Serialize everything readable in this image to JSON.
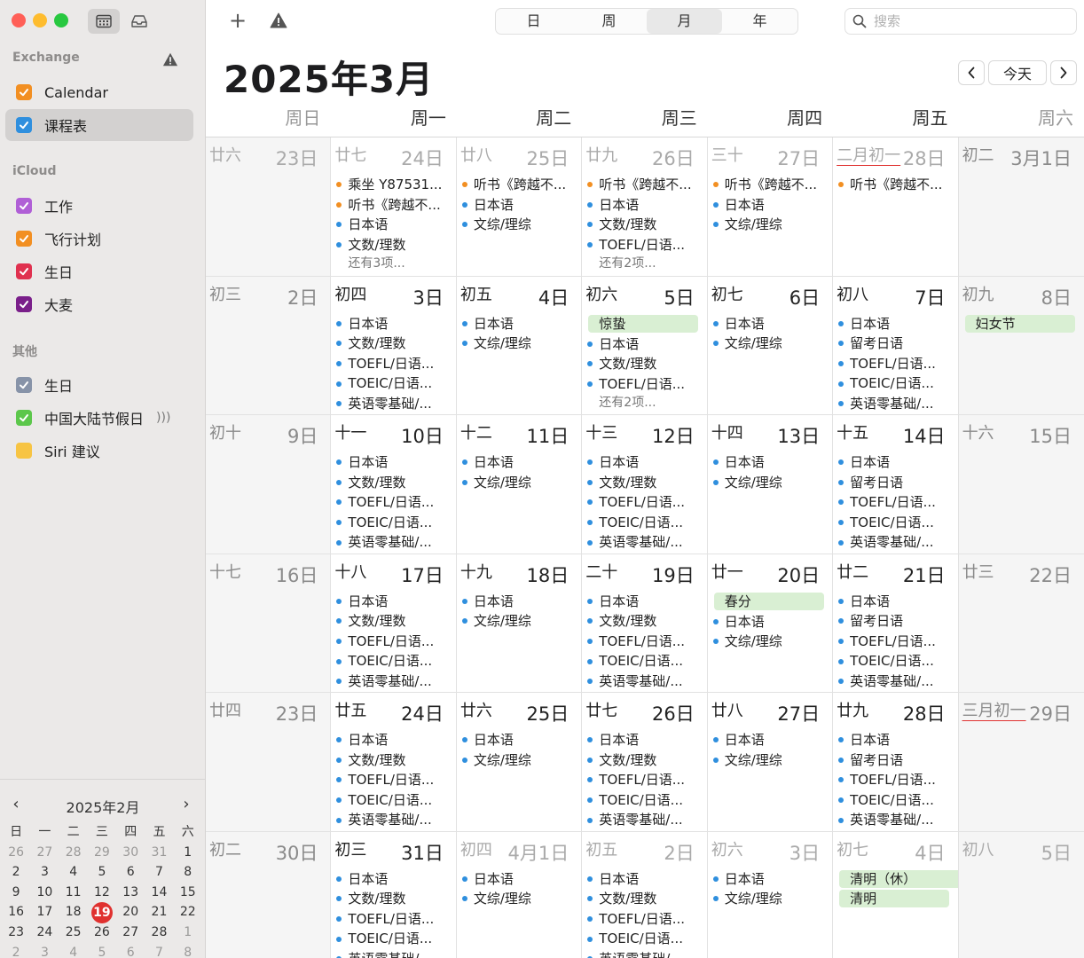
{
  "sidebar": {
    "sections": [
      {
        "title": "Exchange",
        "warning": true,
        "items": [
          {
            "label": "Calendar",
            "color": "#f28f22",
            "selected": false
          },
          {
            "label": "课程表",
            "color": "#2f8fde",
            "selected": true
          }
        ]
      },
      {
        "title": "iCloud",
        "items": [
          {
            "label": "工作",
            "color": "#b05fd6"
          },
          {
            "label": "飞行计划",
            "color": "#f28f22"
          },
          {
            "label": "生日",
            "color": "#e0314f"
          },
          {
            "label": "大麦",
            "color": "#7a1f8a"
          }
        ]
      },
      {
        "title": "其他",
        "items": [
          {
            "label": "生日",
            "color": "#8793a8"
          },
          {
            "label": "中国大陆节假日",
            "color": "#5cc74b",
            "broadcast": true
          },
          {
            "label": "Siri 建议",
            "color": "#f7c443",
            "unchecked": true
          }
        ]
      }
    ],
    "mini_calendar": {
      "title": "2025年2月",
      "weekday_heads": [
        "日",
        "一",
        "二",
        "三",
        "四",
        "五",
        "六"
      ],
      "weeks": [
        [
          "26",
          "27",
          "28",
          "29",
          "30",
          "31",
          "1"
        ],
        [
          "2",
          "3",
          "4",
          "5",
          "6",
          "7",
          "8"
        ],
        [
          "9",
          "10",
          "11",
          "12",
          "13",
          "14",
          "15"
        ],
        [
          "16",
          "17",
          "18",
          "19",
          "20",
          "21",
          "22"
        ],
        [
          "23",
          "24",
          "25",
          "26",
          "27",
          "28",
          "1"
        ],
        [
          "2",
          "3",
          "4",
          "5",
          "6",
          "7",
          "8"
        ]
      ],
      "dim_first_row_count": 6,
      "dim_last_row_from_index": 6,
      "today": "19"
    }
  },
  "toolbar": {
    "views": [
      "日",
      "周",
      "月",
      "年"
    ],
    "active_view": "月",
    "search_placeholder": "搜索"
  },
  "header": {
    "month_title": "2025年3月",
    "today_label": "今天",
    "weekdays": [
      "周日",
      "周一",
      "周二",
      "周三",
      "周四",
      "周五",
      "周六"
    ]
  },
  "weeks": [
    [
      {
        "lunar": "廿六",
        "day": "23日",
        "other": true,
        "events": []
      },
      {
        "lunar": "廿七",
        "day": "24日",
        "other": true,
        "events": [
          {
            "t": "乘坐 Y87531...",
            "c": "orange"
          },
          {
            "t": "听书《跨越不...",
            "c": "orange"
          },
          {
            "t": "日本语",
            "c": "blue"
          },
          {
            "t": "文数/理数",
            "c": "blue"
          }
        ],
        "more": "还有3项..."
      },
      {
        "lunar": "廿八",
        "day": "25日",
        "other": true,
        "events": [
          {
            "t": "听书《跨越不...",
            "c": "orange"
          },
          {
            "t": "日本语",
            "c": "blue"
          },
          {
            "t": "文综/理综",
            "c": "blue"
          }
        ]
      },
      {
        "lunar": "廿九",
        "day": "26日",
        "other": true,
        "events": [
          {
            "t": "听书《跨越不...",
            "c": "orange"
          },
          {
            "t": "日本语",
            "c": "blue"
          },
          {
            "t": "文数/理数",
            "c": "blue"
          },
          {
            "t": "TOEFL/日语...",
            "c": "blue"
          }
        ],
        "more": "还有2项..."
      },
      {
        "lunar": "三十",
        "day": "27日",
        "other": true,
        "events": [
          {
            "t": "听书《跨越不...",
            "c": "orange"
          },
          {
            "t": "日本语",
            "c": "blue"
          },
          {
            "t": "文综/理综",
            "c": "blue"
          }
        ]
      },
      {
        "lunar": "二月初一",
        "day": "28日",
        "other": true,
        "month_start": true,
        "events": [
          {
            "t": "听书《跨越不...",
            "c": "orange"
          }
        ]
      },
      {
        "lunar": "初二",
        "day": "3月1日",
        "events": []
      }
    ],
    [
      {
        "lunar": "初三",
        "day": "2日",
        "events": []
      },
      {
        "lunar": "初四",
        "day": "3日",
        "events": [
          {
            "t": "日本语",
            "c": "blue"
          },
          {
            "t": "文数/理数",
            "c": "blue"
          },
          {
            "t": "TOEFL/日语...",
            "c": "blue"
          },
          {
            "t": "TOEIC/日语...",
            "c": "blue"
          },
          {
            "t": "英语零基础/...",
            "c": "blue"
          }
        ]
      },
      {
        "lunar": "初五",
        "day": "4日",
        "events": [
          {
            "t": "日本语",
            "c": "blue"
          },
          {
            "t": "文综/理综",
            "c": "blue"
          }
        ]
      },
      {
        "lunar": "初六",
        "day": "5日",
        "allday": [
          "惊蛰"
        ],
        "events": [
          {
            "t": "日本语",
            "c": "blue"
          },
          {
            "t": "文数/理数",
            "c": "blue"
          },
          {
            "t": "TOEFL/日语...",
            "c": "blue"
          }
        ],
        "more": "还有2项..."
      },
      {
        "lunar": "初七",
        "day": "6日",
        "events": [
          {
            "t": "日本语",
            "c": "blue"
          },
          {
            "t": "文综/理综",
            "c": "blue"
          }
        ]
      },
      {
        "lunar": "初八",
        "day": "7日",
        "events": [
          {
            "t": "日本语",
            "c": "blue"
          },
          {
            "t": "留考日语",
            "c": "blue"
          },
          {
            "t": "TOEFL/日语...",
            "c": "blue"
          },
          {
            "t": "TOEIC/日语...",
            "c": "blue"
          },
          {
            "t": "英语零基础/...",
            "c": "blue"
          }
        ]
      },
      {
        "lunar": "初九",
        "day": "8日",
        "allday": [
          "妇女节"
        ],
        "events": []
      }
    ],
    [
      {
        "lunar": "初十",
        "day": "9日",
        "events": []
      },
      {
        "lunar": "十一",
        "day": "10日",
        "events": [
          {
            "t": "日本语",
            "c": "blue"
          },
          {
            "t": "文数/理数",
            "c": "blue"
          },
          {
            "t": "TOEFL/日语...",
            "c": "blue"
          },
          {
            "t": "TOEIC/日语...",
            "c": "blue"
          },
          {
            "t": "英语零基础/...",
            "c": "blue"
          }
        ]
      },
      {
        "lunar": "十二",
        "day": "11日",
        "events": [
          {
            "t": "日本语",
            "c": "blue"
          },
          {
            "t": "文综/理综",
            "c": "blue"
          }
        ]
      },
      {
        "lunar": "十三",
        "day": "12日",
        "events": [
          {
            "t": "日本语",
            "c": "blue"
          },
          {
            "t": "文数/理数",
            "c": "blue"
          },
          {
            "t": "TOEFL/日语...",
            "c": "blue"
          },
          {
            "t": "TOEIC/日语...",
            "c": "blue"
          },
          {
            "t": "英语零基础/...",
            "c": "blue"
          }
        ]
      },
      {
        "lunar": "十四",
        "day": "13日",
        "events": [
          {
            "t": "日本语",
            "c": "blue"
          },
          {
            "t": "文综/理综",
            "c": "blue"
          }
        ]
      },
      {
        "lunar": "十五",
        "day": "14日",
        "events": [
          {
            "t": "日本语",
            "c": "blue"
          },
          {
            "t": "留考日语",
            "c": "blue"
          },
          {
            "t": "TOEFL/日语...",
            "c": "blue"
          },
          {
            "t": "TOEIC/日语...",
            "c": "blue"
          },
          {
            "t": "英语零基础/...",
            "c": "blue"
          }
        ]
      },
      {
        "lunar": "十六",
        "day": "15日",
        "events": []
      }
    ],
    [
      {
        "lunar": "十七",
        "day": "16日",
        "events": []
      },
      {
        "lunar": "十八",
        "day": "17日",
        "events": [
          {
            "t": "日本语",
            "c": "blue"
          },
          {
            "t": "文数/理数",
            "c": "blue"
          },
          {
            "t": "TOEFL/日语...",
            "c": "blue"
          },
          {
            "t": "TOEIC/日语...",
            "c": "blue"
          },
          {
            "t": "英语零基础/...",
            "c": "blue"
          }
        ]
      },
      {
        "lunar": "十九",
        "day": "18日",
        "events": [
          {
            "t": "日本语",
            "c": "blue"
          },
          {
            "t": "文综/理综",
            "c": "blue"
          }
        ]
      },
      {
        "lunar": "二十",
        "day": "19日",
        "events": [
          {
            "t": "日本语",
            "c": "blue"
          },
          {
            "t": "文数/理数",
            "c": "blue"
          },
          {
            "t": "TOEFL/日语...",
            "c": "blue"
          },
          {
            "t": "TOEIC/日语...",
            "c": "blue"
          },
          {
            "t": "英语零基础/...",
            "c": "blue"
          }
        ]
      },
      {
        "lunar": "廿一",
        "day": "20日",
        "allday": [
          "春分"
        ],
        "events": [
          {
            "t": "日本语",
            "c": "blue"
          },
          {
            "t": "文综/理综",
            "c": "blue"
          }
        ]
      },
      {
        "lunar": "廿二",
        "day": "21日",
        "events": [
          {
            "t": "日本语",
            "c": "blue"
          },
          {
            "t": "留考日语",
            "c": "blue"
          },
          {
            "t": "TOEFL/日语...",
            "c": "blue"
          },
          {
            "t": "TOEIC/日语...",
            "c": "blue"
          },
          {
            "t": "英语零基础/...",
            "c": "blue"
          }
        ]
      },
      {
        "lunar": "廿三",
        "day": "22日",
        "events": []
      }
    ],
    [
      {
        "lunar": "廿四",
        "day": "23日",
        "events": []
      },
      {
        "lunar": "廿五",
        "day": "24日",
        "events": [
          {
            "t": "日本语",
            "c": "blue"
          },
          {
            "t": "文数/理数",
            "c": "blue"
          },
          {
            "t": "TOEFL/日语...",
            "c": "blue"
          },
          {
            "t": "TOEIC/日语...",
            "c": "blue"
          },
          {
            "t": "英语零基础/...",
            "c": "blue"
          }
        ]
      },
      {
        "lunar": "廿六",
        "day": "25日",
        "events": [
          {
            "t": "日本语",
            "c": "blue"
          },
          {
            "t": "文综/理综",
            "c": "blue"
          }
        ]
      },
      {
        "lunar": "廿七",
        "day": "26日",
        "events": [
          {
            "t": "日本语",
            "c": "blue"
          },
          {
            "t": "文数/理数",
            "c": "blue"
          },
          {
            "t": "TOEFL/日语...",
            "c": "blue"
          },
          {
            "t": "TOEIC/日语...",
            "c": "blue"
          },
          {
            "t": "英语零基础/...",
            "c": "blue"
          }
        ]
      },
      {
        "lunar": "廿八",
        "day": "27日",
        "events": [
          {
            "t": "日本语",
            "c": "blue"
          },
          {
            "t": "文综/理综",
            "c": "blue"
          }
        ]
      },
      {
        "lunar": "廿九",
        "day": "28日",
        "events": [
          {
            "t": "日本语",
            "c": "blue"
          },
          {
            "t": "留考日语",
            "c": "blue"
          },
          {
            "t": "TOEFL/日语...",
            "c": "blue"
          },
          {
            "t": "TOEIC/日语...",
            "c": "blue"
          },
          {
            "t": "英语零基础/...",
            "c": "blue"
          }
        ]
      },
      {
        "lunar": "三月初一",
        "day": "29日",
        "month_start": true,
        "events": []
      }
    ],
    [
      {
        "lunar": "初二",
        "day": "30日",
        "events": []
      },
      {
        "lunar": "初三",
        "day": "31日",
        "events": [
          {
            "t": "日本语",
            "c": "blue"
          },
          {
            "t": "文数/理数",
            "c": "blue"
          },
          {
            "t": "TOEFL/日语...",
            "c": "blue"
          },
          {
            "t": "TOEIC/日语...",
            "c": "blue"
          },
          {
            "t": "英语零基础/...",
            "c": "blue"
          }
        ]
      },
      {
        "lunar": "初四",
        "day": "4月1日",
        "other": true,
        "events": [
          {
            "t": "日本语",
            "c": "blue"
          },
          {
            "t": "文综/理综",
            "c": "blue"
          }
        ]
      },
      {
        "lunar": "初五",
        "day": "2日",
        "other": true,
        "events": [
          {
            "t": "日本语",
            "c": "blue"
          },
          {
            "t": "文数/理数",
            "c": "blue"
          },
          {
            "t": "TOEFL/日语...",
            "c": "blue"
          },
          {
            "t": "TOEIC/日语...",
            "c": "blue"
          },
          {
            "t": "英语零基础/...",
            "c": "blue"
          }
        ]
      },
      {
        "lunar": "初六",
        "day": "3日",
        "other": true,
        "events": [
          {
            "t": "日本语",
            "c": "blue"
          },
          {
            "t": "文综/理综",
            "c": "blue"
          }
        ]
      },
      {
        "lunar": "初七",
        "day": "4日",
        "other": true,
        "allday": [
          "清明（休）",
          "清明"
        ],
        "allday_span_first": true,
        "events": []
      },
      {
        "lunar": "初八",
        "day": "5日",
        "other": true,
        "events": []
      }
    ]
  ]
}
